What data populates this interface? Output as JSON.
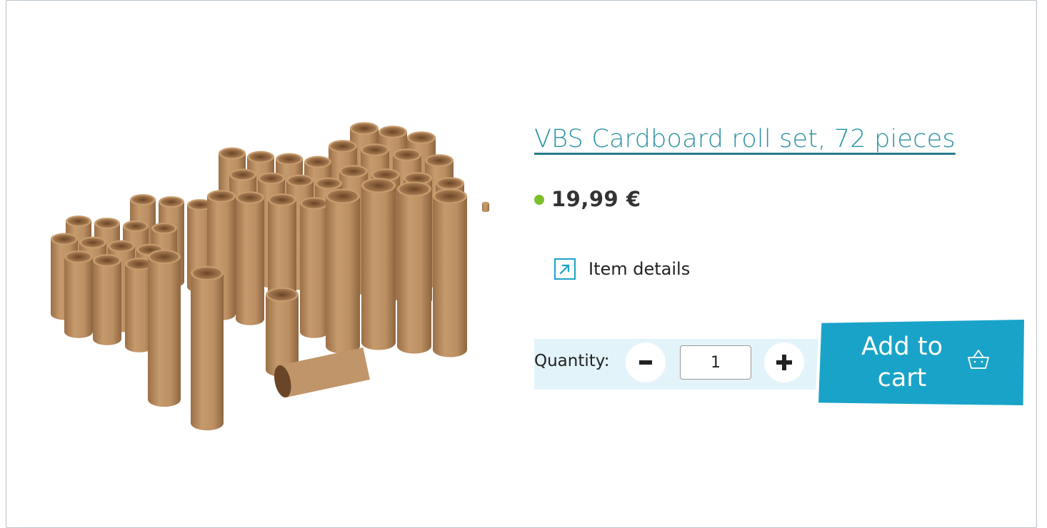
{
  "product": {
    "title": "VBS Cardboard roll set, 72 pieces",
    "image_description": "cardboard-rolls-photo",
    "price": "19,99 €",
    "stock_color": "#7bbf2a",
    "details_label": "Item details"
  },
  "quantity": {
    "label": "Quantity:",
    "value": "1",
    "minus_label": "−",
    "plus_label": "+"
  },
  "cart": {
    "label": "Add to cart",
    "icon": "basket-icon",
    "color": "#1aa3c8"
  },
  "colors": {
    "link": "#2a92a6",
    "accent": "#1ba3c9",
    "band": "#e3f3fa"
  }
}
